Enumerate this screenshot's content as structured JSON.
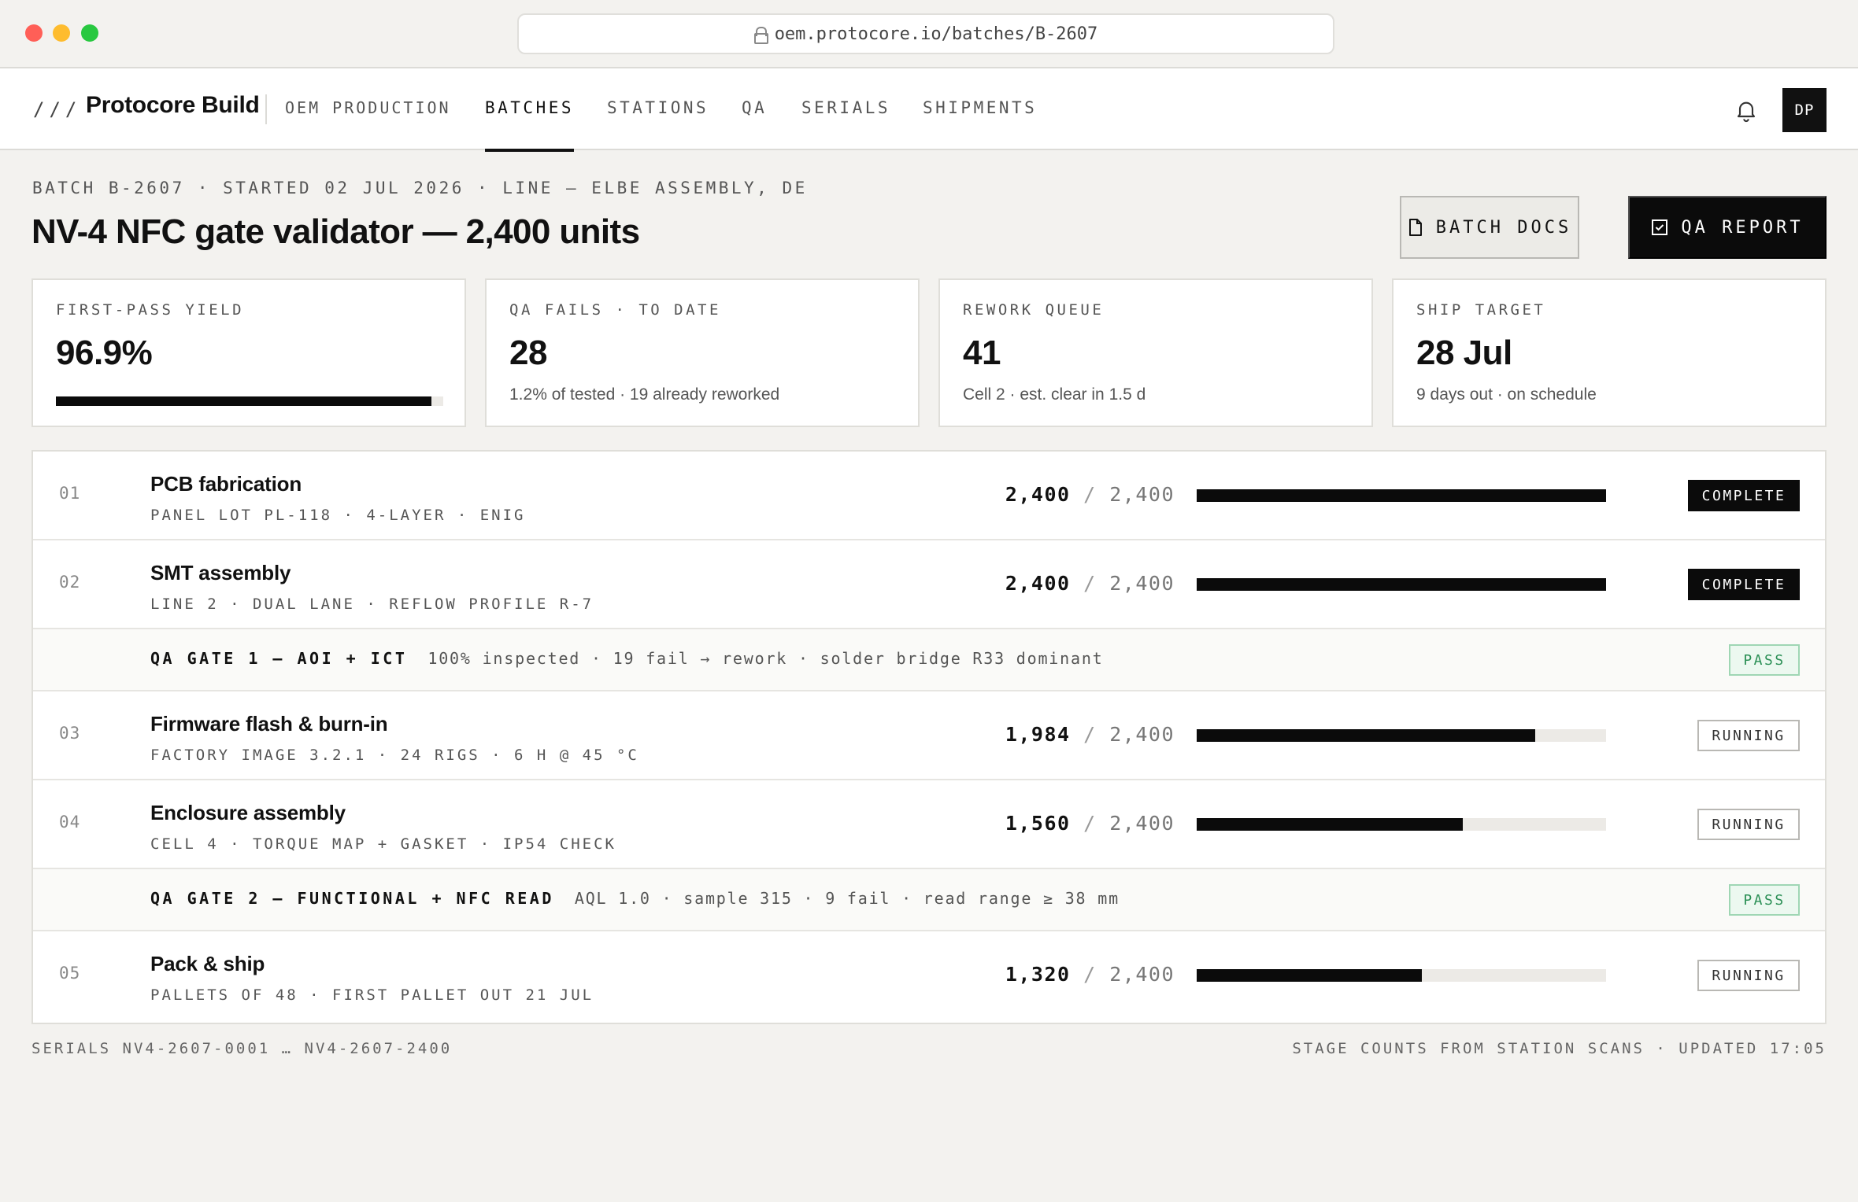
{
  "browser": {
    "url": "oem.protocore.io/batches/B-2607"
  },
  "nav": {
    "slashes": "///",
    "brand": "Protocore Build",
    "brand_sub": "OEM PRODUCTION",
    "tabs": [
      {
        "label": "BATCHES",
        "active": true
      },
      {
        "label": "STATIONS",
        "active": false
      },
      {
        "label": "QA",
        "active": false
      },
      {
        "label": "SERIALS",
        "active": false
      },
      {
        "label": "SHIPMENTS",
        "active": false
      }
    ],
    "avatar": "DP"
  },
  "header": {
    "meta": "BATCH B-2607  ·  STARTED 02 JUL 2026  ·  LINE — ELBE ASSEMBLY, DE",
    "title": "NV-4 NFC gate validator — 2,400 units",
    "docs_button": "BATCH DOCS",
    "qa_button": "QA REPORT"
  },
  "stats": [
    {
      "label": "FIRST-PASS YIELD",
      "value": "96.9%",
      "sub": "",
      "progress": 0.969
    },
    {
      "label": "QA FAILS  ·  TO DATE",
      "value": "28",
      "sub": "1.2% of tested · 19 already reworked"
    },
    {
      "label": "REWORK QUEUE",
      "value": "41",
      "sub": "Cell 2 · est. clear in 1.5 d"
    },
    {
      "label": "SHIP TARGET",
      "value": "28 Jul",
      "sub": "9 days out · on schedule"
    }
  ],
  "rows": [
    {
      "kind": "stage",
      "num": "01",
      "name": "PCB fabrication",
      "detail": "PANEL LOT PL-118  ·  4-LAYER  ·  ENIG",
      "done": "2,400",
      "total": "2,400",
      "progress": 1.0,
      "status": "COMPLETE",
      "status_kind": "complete"
    },
    {
      "kind": "stage",
      "num": "02",
      "name": "SMT assembly",
      "detail": "LINE 2  ·  DUAL LANE  ·  REFLOW PROFILE R-7",
      "done": "2,400",
      "total": "2,400",
      "progress": 1.0,
      "status": "COMPLETE",
      "status_kind": "complete"
    },
    {
      "kind": "gate",
      "name": "QA GATE 1 — AOI + ICT",
      "info": "100% inspected  ·  19 fail → rework  ·  solder bridge R33 dominant",
      "status": "PASS"
    },
    {
      "kind": "stage",
      "num": "03",
      "name": "Firmware flash & burn-in",
      "detail": "FACTORY IMAGE 3.2.1  ·  24 RIGS  ·  6 H @ 45 °C",
      "done": "1,984",
      "total": "2,400",
      "progress": 0.8267,
      "status": "RUNNING",
      "status_kind": "running"
    },
    {
      "kind": "stage",
      "num": "04",
      "name": "Enclosure assembly",
      "detail": "CELL 4  ·  TORQUE MAP + GASKET  ·  IP54 CHECK",
      "done": "1,560",
      "total": "2,400",
      "progress": 0.65,
      "status": "RUNNING",
      "status_kind": "running"
    },
    {
      "kind": "gate",
      "name": "QA GATE 2 — FUNCTIONAL + NFC READ",
      "info": "AQL 1.0  ·  sample 315  ·  9 fail  ·  read range ≥ 38 mm",
      "status": "PASS"
    },
    {
      "kind": "stage",
      "num": "05",
      "name": "Pack & ship",
      "detail": "PALLETS OF 48  ·  FIRST PALLET OUT 21 JUL",
      "done": "1,320",
      "total": "2,400",
      "progress": 0.55,
      "status": "RUNNING",
      "status_kind": "running"
    }
  ],
  "footer": {
    "left": "SERIALS NV4-2607-0001 … NV4-2607-2400",
    "right": "STAGE COUNTS FROM STATION SCANS  ·  UPDATED 17:05"
  },
  "colors": {
    "accent": "#0b0b0b",
    "pass": "#2a8f55",
    "background": "#f3f2ef"
  }
}
